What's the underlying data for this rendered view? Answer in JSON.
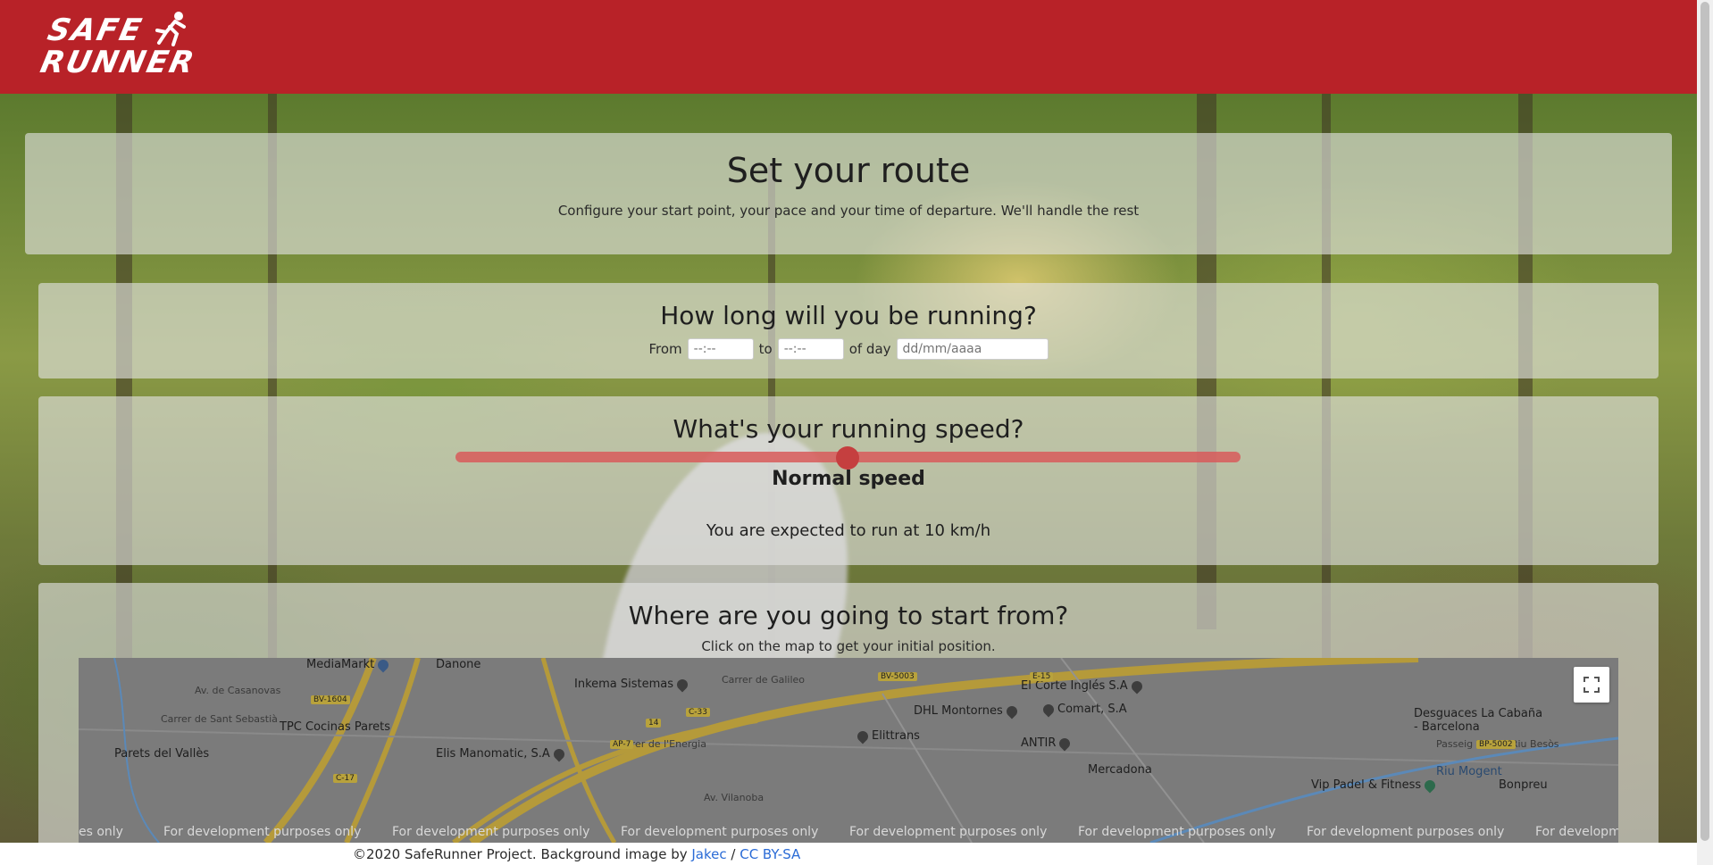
{
  "brand": {
    "line1": "SAFE",
    "line2": "RUNNER"
  },
  "route": {
    "title": "Set your route",
    "subtitle": "Configure your start point, your pace and your time of departure. We'll handle the rest"
  },
  "time": {
    "title": "How long will you be running?",
    "from_label": "From",
    "from_placeholder": "--:--",
    "to_label": "to",
    "to_placeholder": "--:--",
    "day_label": "of day",
    "day_placeholder": "dd/mm/aaaa"
  },
  "speed": {
    "title": "What's your running speed?",
    "slider_position_pct": 50,
    "level_label": "Normal speed",
    "note": "You are expected to run at 10 km/h"
  },
  "start": {
    "title": "Where are you going to start from?",
    "hint": "Click on the map to get your initial position."
  },
  "map": {
    "pois": [
      "MediaMarkt",
      "Danone",
      "Inkema Sistemas",
      "El Corte Inglés S.A",
      "TPC Cocinas Parets",
      "DHL Montornes",
      "Comart, S.A",
      "Desguaces La Cabaña - Barcelona",
      "Elittrans",
      "ANTIR",
      "Parets del Vallès",
      "Elis Manomatic, S.A",
      "Mercadona",
      "Vip Padel & Fitness",
      "Bonpreu"
    ],
    "road_badges": [
      "BV-1604",
      "BV-5003",
      "E-15",
      "C-33",
      "AP-7",
      "C-17",
      "BP-5002",
      "14"
    ],
    "street_labels": [
      "Av. de Casanovas",
      "Carrer de Sant Sebastià",
      "Carrer de Galileo",
      "Carrer de l'Energia",
      "Av. Vilanoba",
      "Passeig Fluvial Riu Besòs",
      "Riu Mogent"
    ],
    "dev_watermark": "For development purposes only",
    "dev_watermark_first": "es only",
    "dev_watermark_last": "For developm",
    "fullscreen_icon": "fullscreen-icon"
  },
  "footer": {
    "prefix": "©2020 SafeRunner Project. Background image by ",
    "author": "Jakec",
    "separator": " / ",
    "license": "CC BY-SA"
  },
  "colors": {
    "header": "#b82228",
    "slider": "#d85b5b",
    "thumb": "#c53f3f",
    "link": "#2a6bd6"
  }
}
